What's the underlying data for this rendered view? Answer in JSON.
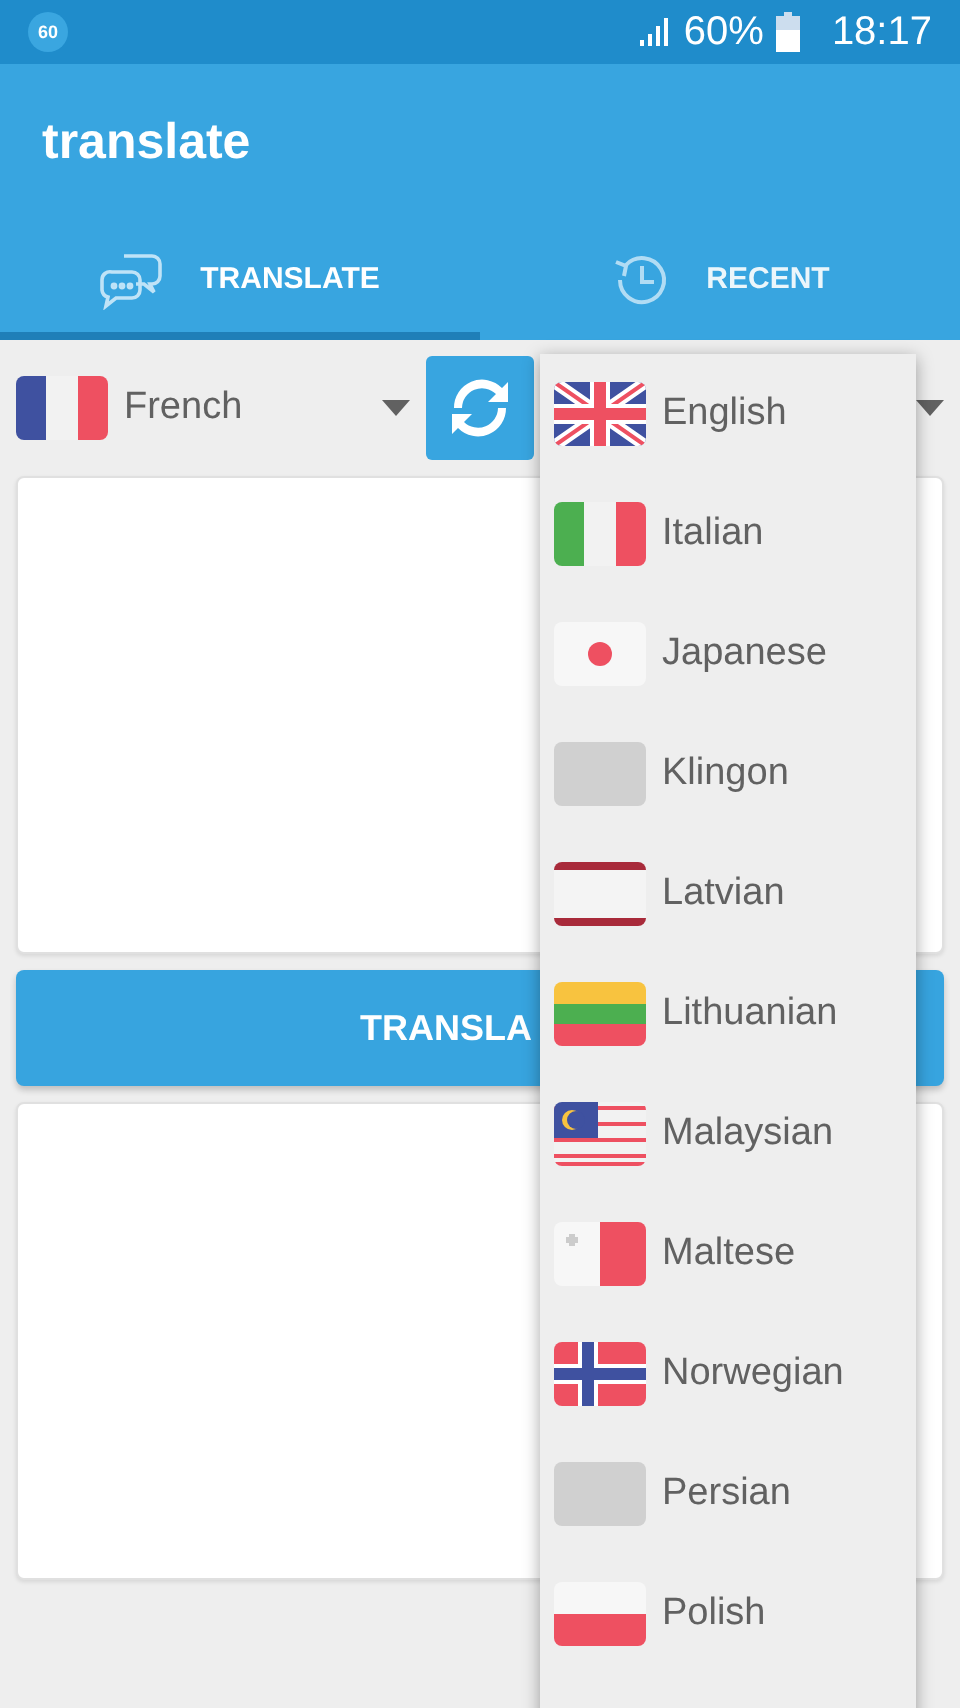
{
  "status_bar": {
    "badge": "60",
    "battery": "60%",
    "time": "18:17"
  },
  "app_bar": {
    "title": "translate"
  },
  "tabs": [
    {
      "label": "TRANSLATE",
      "kind": "chat",
      "selected": true
    },
    {
      "label": "RECENT",
      "kind": "history",
      "selected": false
    }
  ],
  "source_language": {
    "label": "French",
    "kind": "france"
  },
  "translate_button": {
    "label": "TRANSLA"
  },
  "language_menu": [
    {
      "label": "English",
      "kind": "uk"
    },
    {
      "label": "Italian",
      "kind": "italy"
    },
    {
      "label": "Japanese",
      "kind": "japan"
    },
    {
      "label": "Klingon",
      "kind": "blank"
    },
    {
      "label": "Latvian",
      "kind": "latvia"
    },
    {
      "label": "Lithuanian",
      "kind": "lithuania"
    },
    {
      "label": "Malaysian",
      "kind": "malaysia"
    },
    {
      "label": "Maltese",
      "kind": "malta"
    },
    {
      "label": "Norwegian",
      "kind": "norway"
    },
    {
      "label": "Persian",
      "kind": "blank"
    },
    {
      "label": "Polish",
      "kind": "poland"
    }
  ]
}
